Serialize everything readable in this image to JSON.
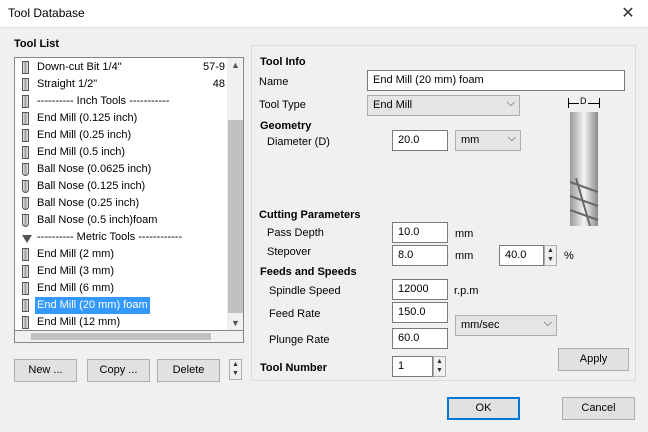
{
  "window": {
    "title": "Tool Database",
    "close_glyph": "✕"
  },
  "tool_list": {
    "heading": "Tool List",
    "items": [
      {
        "label": "Down-cut Bit 1/4\"",
        "value": "57-9",
        "icon": "down-cut-bit-icon"
      },
      {
        "label": "Straight 1/2\"",
        "value": "48",
        "icon": "end-mill-icon"
      },
      {
        "label": "---------- Inch Tools -----------",
        "value": "",
        "icon": "end-mill-icon"
      },
      {
        "label": "End Mill (0.125 inch)",
        "value": "",
        "icon": "end-mill-icon"
      },
      {
        "label": "End Mill (0.25 inch)",
        "value": "",
        "icon": "end-mill-icon"
      },
      {
        "label": "End Mill (0.5 inch)",
        "value": "",
        "icon": "end-mill-icon"
      },
      {
        "label": "Ball Nose (0.0625 inch)",
        "value": "",
        "icon": "ball-nose-icon"
      },
      {
        "label": "Ball Nose (0.125 inch)",
        "value": "",
        "icon": "ball-nose-icon"
      },
      {
        "label": "Ball Nose (0.25 inch)",
        "value": "",
        "icon": "ball-nose-icon"
      },
      {
        "label": "Ball Nose (0.5 inch)foam",
        "value": "",
        "icon": "ball-nose-icon"
      },
      {
        "label": "---------- Metric Tools ------------",
        "value": "",
        "icon": "engraving-bit-icon"
      },
      {
        "label": "End Mill (2 mm)",
        "value": "",
        "icon": "end-mill-icon"
      },
      {
        "label": "End Mill (3 mm)",
        "value": "",
        "icon": "end-mill-icon"
      },
      {
        "label": "End Mill (6 mm)",
        "value": "",
        "icon": "end-mill-icon"
      },
      {
        "label": "End Mill (20 mm) foam",
        "value": "",
        "icon": "end-mill-icon",
        "selected": true
      },
      {
        "label": "End Mill (12 mm)",
        "value": "",
        "icon": "end-mill-icon"
      }
    ],
    "buttons": {
      "new": "New ...",
      "copy": "Copy ...",
      "delete": "Delete"
    }
  },
  "tool_info": {
    "heading": "Tool Info",
    "name_label": "Name",
    "name_value": "End Mill (20 mm) foam",
    "type_label": "Tool Type",
    "type_value": "End Mill",
    "diagram_label": "D"
  },
  "geometry": {
    "heading": "Geometry",
    "diameter_label": "Diameter (D)",
    "diameter_value": "20.0",
    "unit_value": "mm"
  },
  "cutting": {
    "heading": "Cutting Parameters",
    "pass_depth_label": "Pass Depth",
    "pass_depth_value": "10.0",
    "pass_depth_unit": "mm",
    "stepover_label": "Stepover",
    "stepover_value": "8.0",
    "stepover_unit": "mm",
    "stepover_pct_value": "40.0",
    "stepover_pct_unit": "%"
  },
  "feeds": {
    "heading": "Feeds and Speeds",
    "spindle_label": "Spindle Speed",
    "spindle_value": "12000",
    "spindle_unit": "r.p.m",
    "feed_label": "Feed Rate",
    "feed_value": "150.0",
    "plunge_label": "Plunge Rate",
    "plunge_value": "60.0",
    "rate_unit_value": "mm/sec"
  },
  "tool_number": {
    "label": "Tool Number",
    "value": "1"
  },
  "actions": {
    "apply": "Apply",
    "ok": "OK",
    "cancel": "Cancel"
  }
}
